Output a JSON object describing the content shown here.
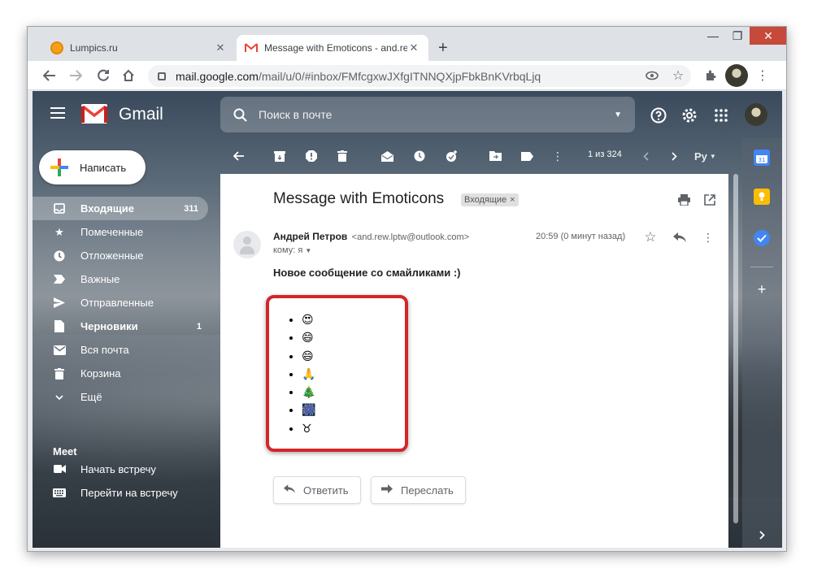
{
  "browser": {
    "tabs": [
      {
        "title": "Lumpics.ru",
        "close": "✕"
      },
      {
        "title": "Message with Emoticons - and.re",
        "close": "✕"
      }
    ],
    "new_tab": "+",
    "window_controls": {
      "min": "—",
      "max": "❐",
      "close": "✕"
    },
    "url_host": "mail.google.com",
    "url_path": "/mail/u/0/#inbox/FMfcgxwJXfgITNNQXjpFbkBnKVrbqLjq"
  },
  "gmail": {
    "logo_text": "Gmail",
    "search_placeholder": "Поиск в почте",
    "compose_label": "Написать",
    "nav": [
      {
        "label": "Входящие",
        "count": "311",
        "icon": "inbox-icon",
        "active": true
      },
      {
        "label": "Помеченные",
        "count": "",
        "icon": "star-icon"
      },
      {
        "label": "Отложенные",
        "count": "",
        "icon": "clock-icon"
      },
      {
        "label": "Важные",
        "count": "",
        "icon": "important-icon"
      },
      {
        "label": "Отправленные",
        "count": "",
        "icon": "send-icon"
      },
      {
        "label": "Черновики",
        "count": "1",
        "icon": "draft-icon",
        "bold": true
      },
      {
        "label": "Вся почта",
        "count": "",
        "icon": "mail-icon"
      },
      {
        "label": "Корзина",
        "count": "",
        "icon": "trash-icon"
      },
      {
        "label": "Ещё",
        "count": "",
        "icon": "chevron-down-icon"
      }
    ],
    "meet": {
      "title": "Meet",
      "items": [
        "Начать встречу",
        "Перейти на встречу"
      ]
    },
    "pager": "1 из 324",
    "lang_badge": "Ру"
  },
  "message": {
    "subject": "Message with Emoticons",
    "label": "Входящие",
    "label_close": "×",
    "sender_name": "Андрей Петров",
    "sender_email": "<and.rew.lptw@outlook.com>",
    "to_line": "кому: я",
    "time": "20:59 (0 минут назад)",
    "body": "Новое сообщение со смайликами :)",
    "emojis": [
      "😍",
      "😄",
      "😄",
      "🙏",
      "🎄",
      "🎆",
      "♉"
    ],
    "reply_label": "Ответить",
    "forward_label": "Переслать"
  },
  "colors": {
    "gmail_red": "#ea4335",
    "highlight": "#d5252a",
    "window_close": "#c7493a"
  }
}
